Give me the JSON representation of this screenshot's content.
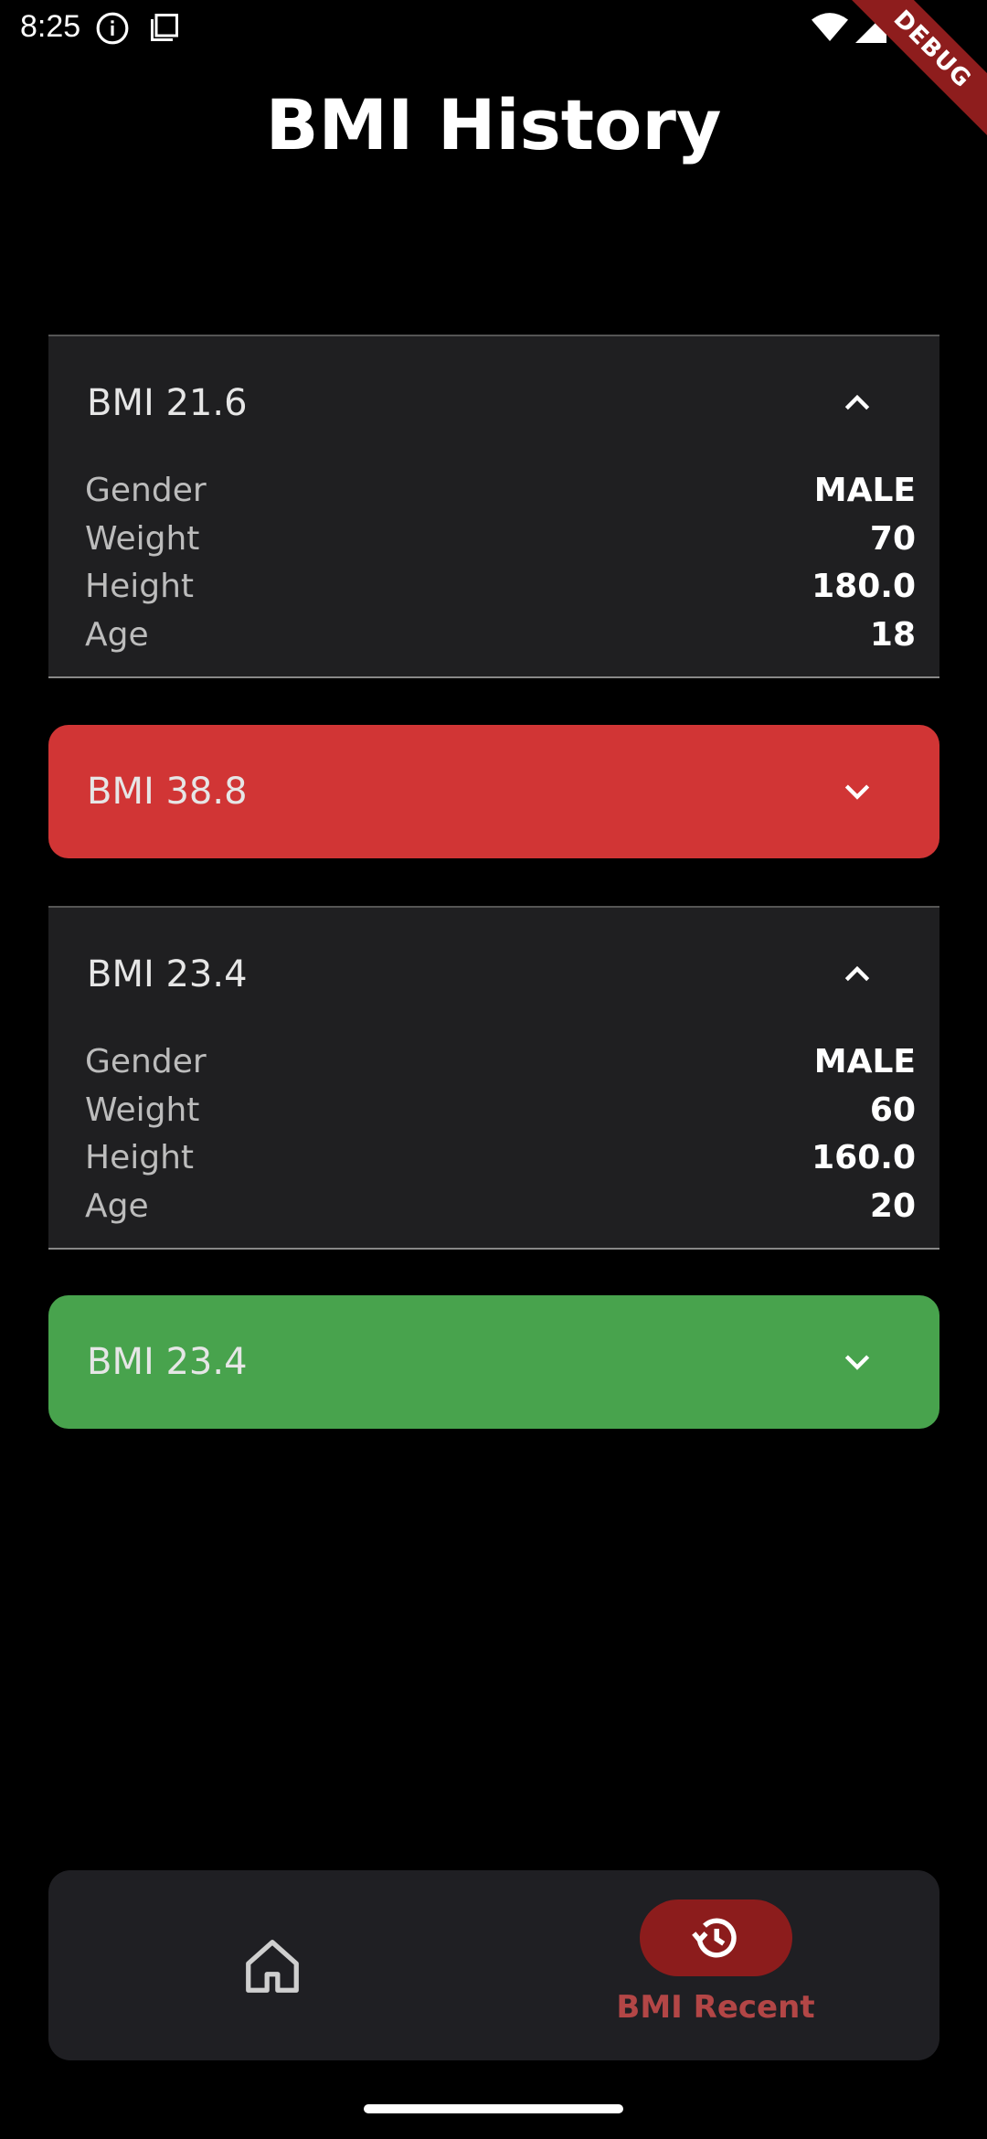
{
  "status_bar": {
    "time": "8:25"
  },
  "debug_banner": "DEBUG",
  "title": "BMI History",
  "colors": {
    "danger": "#d13535",
    "success": "#48a34d",
    "card_dark": "#1f1f21",
    "nav_active": "#8c1c1c"
  },
  "entries": [
    {
      "title": "BMI 21.6",
      "expanded": true,
      "details": [
        {
          "label": "Gender",
          "value": "MALE"
        },
        {
          "label": "Weight",
          "value": "70"
        },
        {
          "label": "Height",
          "value": "180.0"
        },
        {
          "label": "Age",
          "value": "18"
        }
      ]
    },
    {
      "title": "BMI 38.8",
      "expanded": false,
      "color": "#d13535"
    },
    {
      "title": "BMI 23.4",
      "expanded": true,
      "details": [
        {
          "label": "Gender",
          "value": "MALE"
        },
        {
          "label": "Weight",
          "value": "60"
        },
        {
          "label": "Height",
          "value": "160.0"
        },
        {
          "label": "Age",
          "value": "20"
        }
      ]
    },
    {
      "title": "BMI 23.4",
      "expanded": false,
      "color": "#48a34d"
    }
  ],
  "bottom_nav": {
    "items": [
      {
        "icon": "home-icon",
        "label": "",
        "active": false
      },
      {
        "icon": "history-icon",
        "label": "BMI Recent",
        "active": true
      }
    ]
  }
}
